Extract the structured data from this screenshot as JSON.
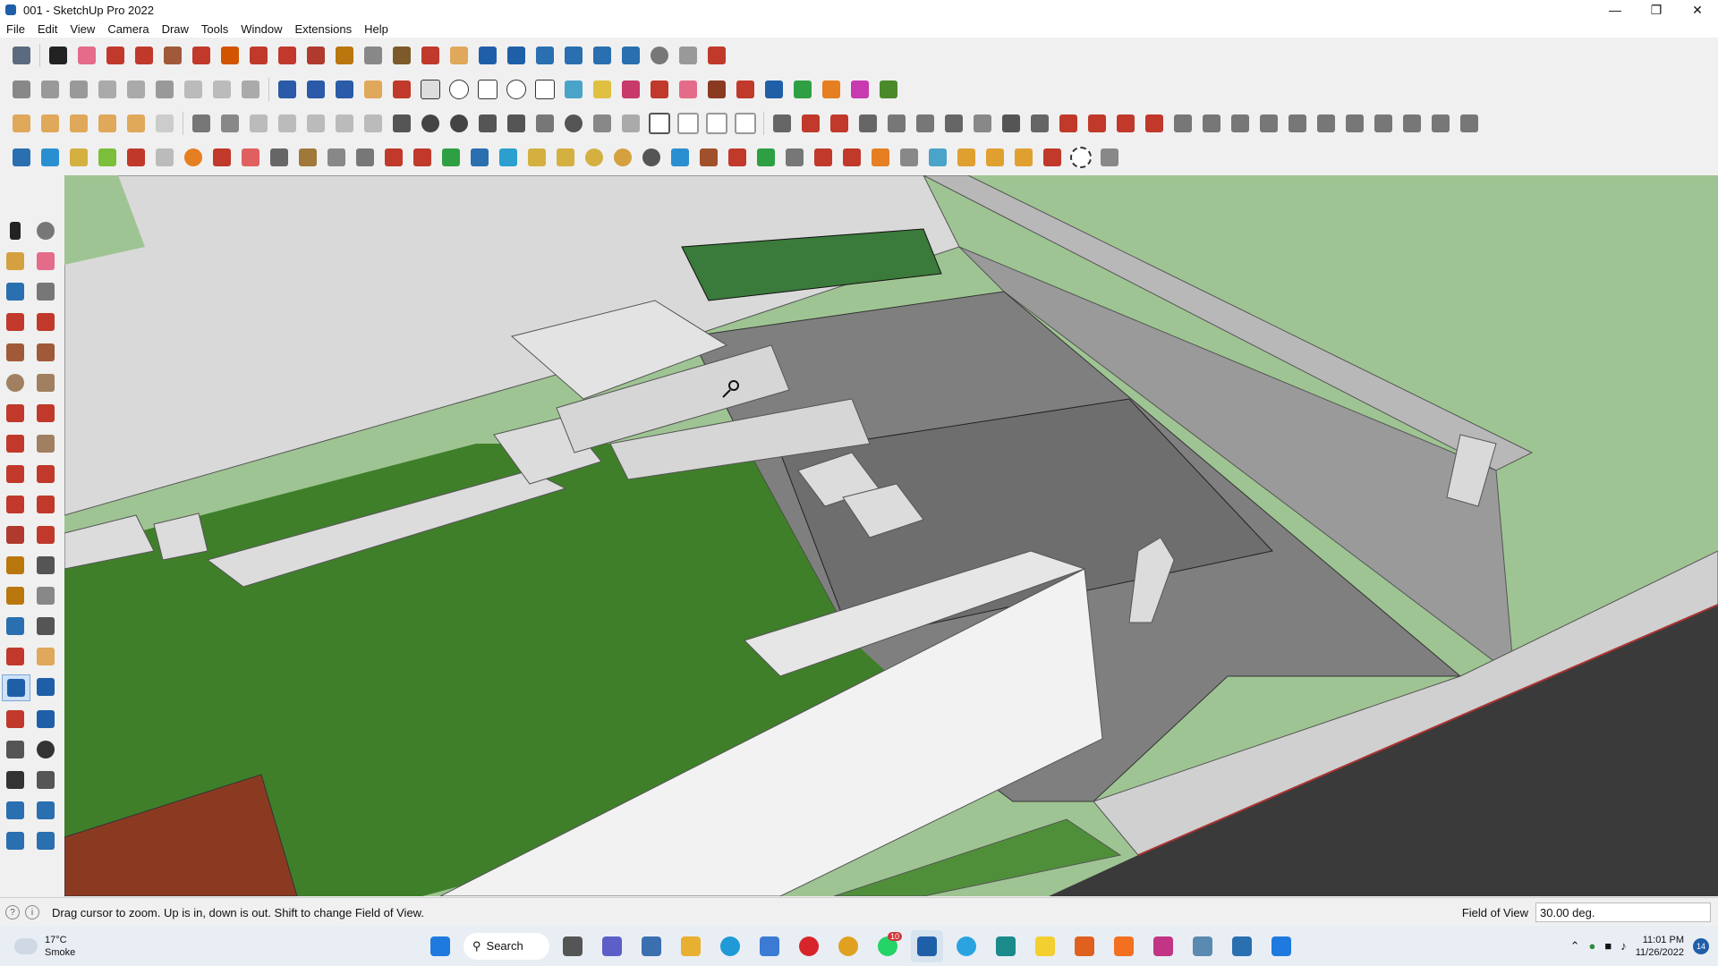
{
  "window": {
    "title": "001 - SketchUp Pro 2022"
  },
  "menu": [
    "File",
    "Edit",
    "View",
    "Camera",
    "Draw",
    "Tools",
    "Window",
    "Extensions",
    "Help"
  ],
  "status": {
    "message": "Drag cursor to zoom.  Up is in, down is out. Shift to change Field of View.",
    "fov_label": "Field of View",
    "fov_value": "30.00 deg."
  },
  "taskbar": {
    "weather_temp": "17°C",
    "weather_desc": "Smoke",
    "search_label": "Search",
    "whatsapp_badge": "10",
    "time": "11:01 PM",
    "date": "11/26/2022",
    "notifications": "14"
  },
  "colors": {
    "accent": "#1f5fa8",
    "lawn": "#3f7f2a",
    "grass_bg": "#9fc493",
    "paving": "#7a7a7a",
    "wall": "#e6e6e6",
    "brick": "#8b3a22"
  }
}
